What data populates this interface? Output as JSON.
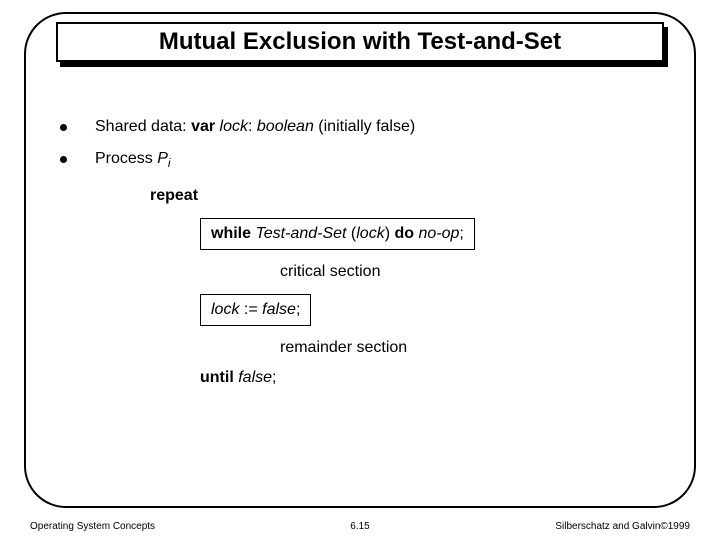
{
  "title": "Mutual Exclusion with Test-and-Set",
  "bullets": {
    "b1_lead": "Shared data: ",
    "b1_kw1": "var ",
    "b1_it1": "lock",
    "b1_rest1": ": ",
    "b1_it2": "boolean ",
    "b1_rest2": "(initially false)",
    "b2_lead": "Process ",
    "b2_P": "P",
    "b2_i": "i"
  },
  "algo": {
    "repeat": "repeat",
    "while_kw": "while ",
    "while_fn": "Test-and-Set ",
    "while_arg_open": "(",
    "while_arg": "lock",
    "while_arg_close": ") ",
    "while_do": "do ",
    "while_noop": "no-op",
    "while_semicolon": ";",
    "critical": "critical section",
    "assign_lhs": "lock ",
    "assign_op": ":= ",
    "assign_rhs": "false",
    "assign_semicolon": ";",
    "remainder": "remainder section",
    "until_kw": "until ",
    "until_cond": "false",
    "until_semicolon": ";"
  },
  "footer": {
    "left": "Operating System Concepts",
    "center": "6.15",
    "right": "Silberschatz and Galvin©1999"
  }
}
